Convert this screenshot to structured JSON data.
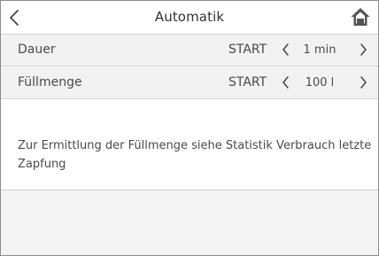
{
  "header": {
    "title": "Automatik",
    "back_icon": "chevron-left-icon",
    "home_icon": "home-icon"
  },
  "rows": [
    {
      "label": "Dauer",
      "start_label": "START",
      "value": "1 min"
    },
    {
      "label": "Füllmenge",
      "start_label": "START",
      "value": "100 l"
    }
  ],
  "info": {
    "text": "Zur Ermittlung der Füllmenge siehe Statistik Verbrauch letzte Zapfung"
  }
}
